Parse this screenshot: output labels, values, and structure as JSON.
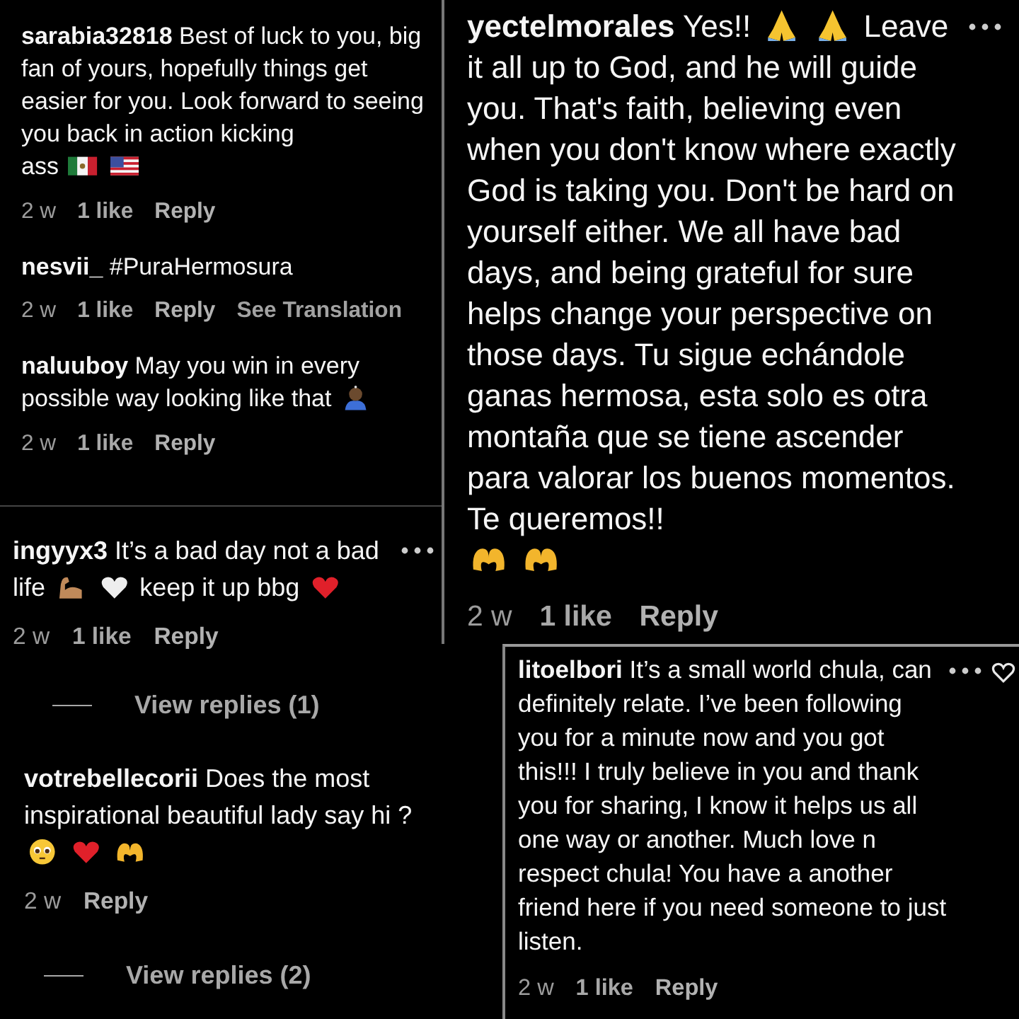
{
  "panels": [
    {
      "comments": [
        {
          "segments": [
            {
              "kind": "paragraph",
              "text": "**sarabia32818** Best of luck to you, big fan of yours, hopefully things get easier for you. Look forward to seeing you back in action kicking"
            },
            {
              "kind": "inline",
              "text": "ass"
            },
            {
              "kind": "flag-mexico"
            },
            {
              "kind": "flag-usa"
            }
          ],
          "meta": [
            {
              "kind": "time",
              "text": "2 w"
            },
            {
              "kind": "likes",
              "text": "1 like"
            },
            {
              "kind": "reply",
              "text": "Reply"
            }
          ]
        },
        {
          "segments": [
            {
              "kind": "paragraph",
              "text": "**nesvii_** #PuraHermosura"
            }
          ],
          "meta": [
            {
              "kind": "time",
              "text": "2 w"
            },
            {
              "kind": "likes",
              "text": "1 like"
            },
            {
              "kind": "reply",
              "text": "Reply"
            },
            {
              "kind": "translate",
              "text": "See Translation"
            }
          ]
        },
        {
          "segments": [
            {
              "kind": "paragraph",
              "text": "**naluuboy** May you win in every"
            },
            {
              "kind": "inline",
              "text": "possible way looking like that"
            },
            {
              "kind": "bowing-person"
            }
          ],
          "meta": [
            {
              "kind": "time",
              "text": "2 w"
            },
            {
              "kind": "likes",
              "text": "1 like"
            },
            {
              "kind": "reply",
              "text": "Reply"
            }
          ]
        }
      ]
    },
    {
      "comments": [
        {
          "more_menu": true,
          "segments": [
            {
              "kind": "paragraph",
              "text": "**ingyyx3** It’s a bad day not a bad"
            },
            {
              "kind": "inline",
              "text": "life"
            },
            {
              "kind": "flexed-arm"
            },
            {
              "kind": "white-heart"
            },
            {
              "kind": "inline",
              "text": "keep it up bbg"
            },
            {
              "kind": "red-heart"
            }
          ],
          "meta": [
            {
              "kind": "time",
              "text": "2 w"
            },
            {
              "kind": "likes",
              "text": "1 like"
            },
            {
              "kind": "reply",
              "text": "Reply"
            }
          ],
          "view_replies": "View replies (1)"
        },
        {
          "segments": [
            {
              "kind": "paragraph",
              "text": "**votrebellecorii** Does the most inspirational beautiful lady say hi ?"
            },
            {
              "kind": "pleading-face"
            },
            {
              "kind": "red-heart"
            },
            {
              "kind": "heart-hands"
            }
          ],
          "meta": [
            {
              "kind": "time",
              "text": "2 w"
            },
            {
              "kind": "reply",
              "text": "Reply"
            }
          ],
          "view_replies": "View replies (2)"
        }
      ]
    },
    {
      "comments": [
        {
          "more_menu": true,
          "segments": [
            {
              "kind": "inline",
              "text": "**yectelmorales** Yes!!"
            },
            {
              "kind": "folded-hands"
            },
            {
              "kind": "folded-hands"
            },
            {
              "kind": "inline",
              "text": "Leave"
            },
            {
              "kind": "paragraph",
              "text": "it all up to God, and he will guide you. That's faith, believing even when you don't know where exactly God is taking you. Don't be hard on yourself either. We all have bad days, and being grateful for sure helps change your perspective on those days. Tu sigue echándole ganas hermosa, esta solo es otra montaña que se tiene ascender para valorar los buenos momentos. Te queremos!!"
            },
            {
              "kind": "heart-hands"
            },
            {
              "kind": "heart-hands"
            }
          ],
          "meta": [
            {
              "kind": "time",
              "text": "2 w"
            },
            {
              "kind": "likes",
              "text": "1 like"
            },
            {
              "kind": "reply",
              "text": "Reply"
            }
          ]
        }
      ]
    },
    {
      "comments": [
        {
          "more_menu": true,
          "liked": false,
          "segments": [
            {
              "kind": "paragraph",
              "text": "**litoelbori** It’s a small world chula, can definitely relate. I’ve been following you for a minute now and you got this!!! I truly believe in you and thank you for sharing, I know it helps us all one way or another. Much love n respect chula! You have a another friend here if you need someone to just listen."
            }
          ],
          "meta": [
            {
              "kind": "time",
              "text": "2 w"
            },
            {
              "kind": "likes",
              "text": "1 like"
            },
            {
              "kind": "reply",
              "text": "Reply"
            }
          ]
        }
      ]
    }
  ]
}
